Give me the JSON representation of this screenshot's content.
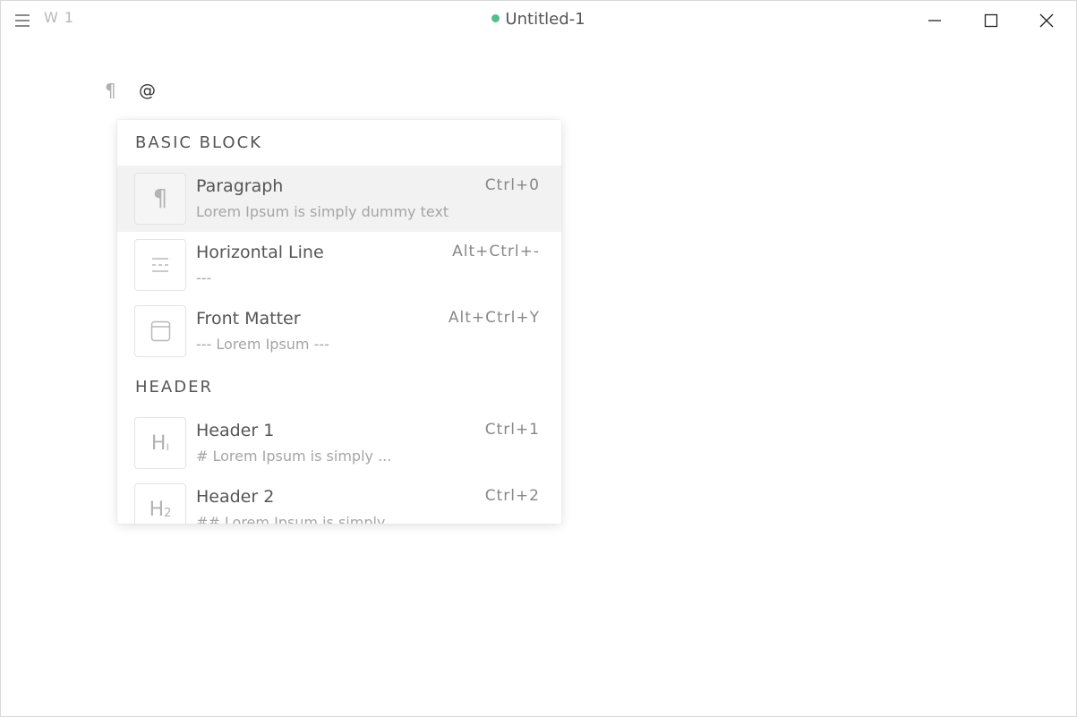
{
  "titlebar": {
    "word_count": "W 1",
    "title": "Untitled-1",
    "status_color": "#4fc08d"
  },
  "editor": {
    "paragraph_marker": "¶",
    "typed_text": "@"
  },
  "quick_insert": {
    "sections": [
      {
        "title": "BASIC BLOCK",
        "items": [
          {
            "label": "Paragraph",
            "desc": "Lorem Ipsum is simply dummy text",
            "shortcut": "Ctrl+0",
            "icon": "paragraph-icon",
            "active": true
          },
          {
            "label": "Horizontal Line",
            "desc": "---",
            "shortcut": "Alt+Ctrl+-",
            "icon": "horizontal-line-icon",
            "active": false
          },
          {
            "label": "Front Matter",
            "desc": "--- Lorem Ipsum ---",
            "shortcut": "Alt+Ctrl+Y",
            "icon": "front-matter-icon",
            "active": false
          }
        ]
      },
      {
        "title": "HEADER",
        "items": [
          {
            "label": "Header 1",
            "desc": "# Lorem Ipsum is simply ...",
            "shortcut": "Ctrl+1",
            "icon": "header-1-icon",
            "active": false
          },
          {
            "label": "Header 2",
            "desc": "## Lorem Ipsum is simply ...",
            "shortcut": "Ctrl+2",
            "icon": "header-2-icon",
            "active": false
          }
        ]
      }
    ]
  }
}
